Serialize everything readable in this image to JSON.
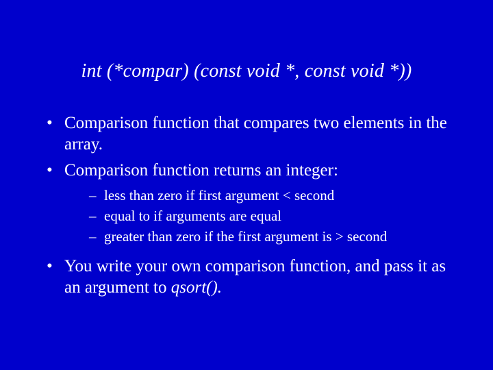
{
  "title": "int (*compar) (const void *, const void *))",
  "bullets": {
    "b1": "Comparison function that compares two elements in the array.",
    "b2": "Comparison function returns an integer:",
    "sub": {
      "s1": "less than zero if first argument  < second",
      "s2": "equal to if arguments are equal",
      "s3": "greater than zero if the first argument is > second"
    },
    "b3_pre": "You write your own comparison function, and pass it as an argument to ",
    "b3_ital": "qsort()."
  }
}
